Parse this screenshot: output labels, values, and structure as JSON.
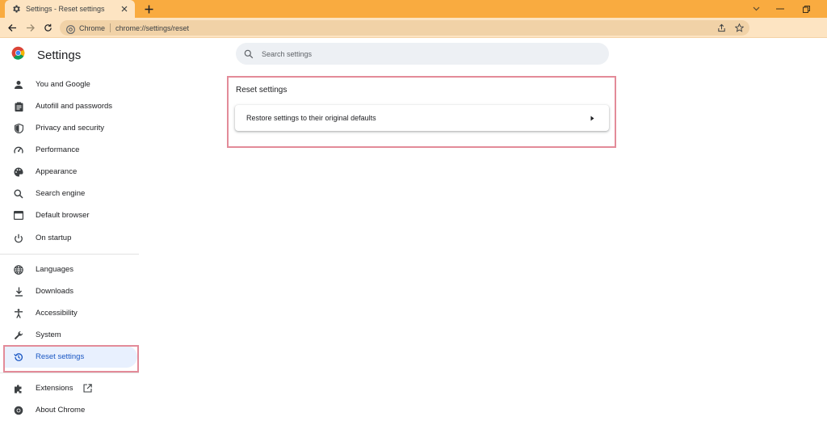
{
  "browser": {
    "tab_title": "Settings - Reset settings",
    "omnibox_site": "Chrome",
    "omnibox_url": "chrome://settings/reset"
  },
  "app": {
    "title": "Settings"
  },
  "search": {
    "placeholder": "Search settings"
  },
  "sidebar": {
    "items": [
      {
        "label": "You and Google",
        "icon": "person-icon"
      },
      {
        "label": "Autofill and passwords",
        "icon": "clipboard-icon"
      },
      {
        "label": "Privacy and security",
        "icon": "shield-icon"
      },
      {
        "label": "Performance",
        "icon": "speedometer-icon"
      },
      {
        "label": "Appearance",
        "icon": "palette-icon"
      },
      {
        "label": "Search engine",
        "icon": "search-icon"
      },
      {
        "label": "Default browser",
        "icon": "browser-window-icon"
      },
      {
        "label": "On startup",
        "icon": "power-icon"
      },
      {
        "label": "Languages",
        "icon": "globe-icon"
      },
      {
        "label": "Downloads",
        "icon": "download-icon"
      },
      {
        "label": "Accessibility",
        "icon": "accessibility-icon"
      },
      {
        "label": "System",
        "icon": "wrench-icon"
      },
      {
        "label": "Reset settings",
        "icon": "history-icon",
        "active": true
      },
      {
        "label": "Extensions",
        "icon": "puzzle-icon"
      },
      {
        "label": "About Chrome",
        "icon": "chrome-icon"
      }
    ]
  },
  "main": {
    "section_title": "Reset settings",
    "rows": [
      {
        "label": "Restore settings to their original defaults"
      }
    ]
  },
  "colors": {
    "tabstrip": "#f9ab40",
    "toolbar": "#fde4c2",
    "highlight": "#e38b99",
    "active_text": "#1a57c3",
    "active_bg": "#e8f0fe"
  }
}
